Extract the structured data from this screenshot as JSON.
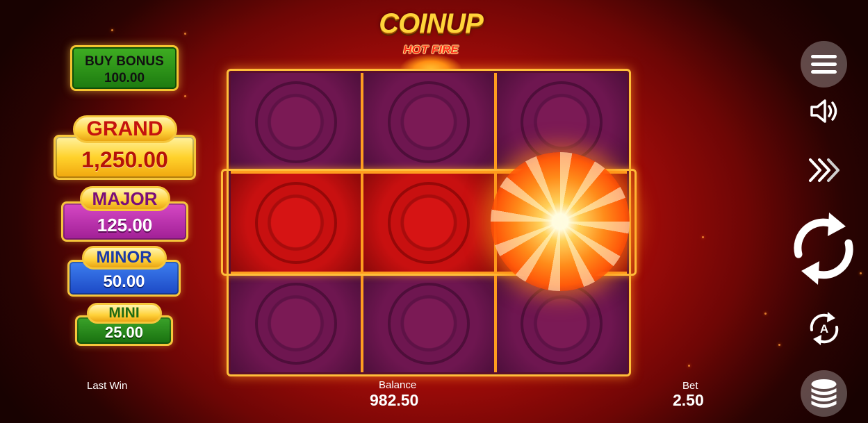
{
  "logo": {
    "title": "COINUP",
    "subtitle": "HOT FIRE"
  },
  "buy_bonus": {
    "label": "BUY BONUS",
    "price": "100.00"
  },
  "jackpots": {
    "grand": {
      "label": "GRAND",
      "value": "1,250.00"
    },
    "major": {
      "label": "MAJOR",
      "value": "125.00"
    },
    "minor": {
      "label": "MINOR",
      "value": "50.00"
    },
    "mini": {
      "label": "MINI",
      "value": "25.00"
    }
  },
  "reels": {
    "rows": 3,
    "cols": 3,
    "highlighted_row": 2,
    "special_symbol": {
      "row": 2,
      "col": 3,
      "type": "fireball"
    }
  },
  "controls": {
    "menu": "menu-icon",
    "sound": "speaker-icon",
    "turbo": "fast-forward-icon",
    "spin": "spin-icon",
    "autoplay": "autoplay-icon",
    "bet": "coin-stack-icon"
  },
  "footer": {
    "last_win_label": "Last Win",
    "balance_label": "Balance",
    "balance_value": "982.50",
    "bet_label": "Bet",
    "bet_value": "2.50"
  },
  "colors": {
    "frame": "#ffbe3a",
    "background": "#b20d0a",
    "grand": "#ffd22b",
    "major": "#a01f95",
    "minor": "#1c48c4",
    "mini": "#18700f"
  }
}
